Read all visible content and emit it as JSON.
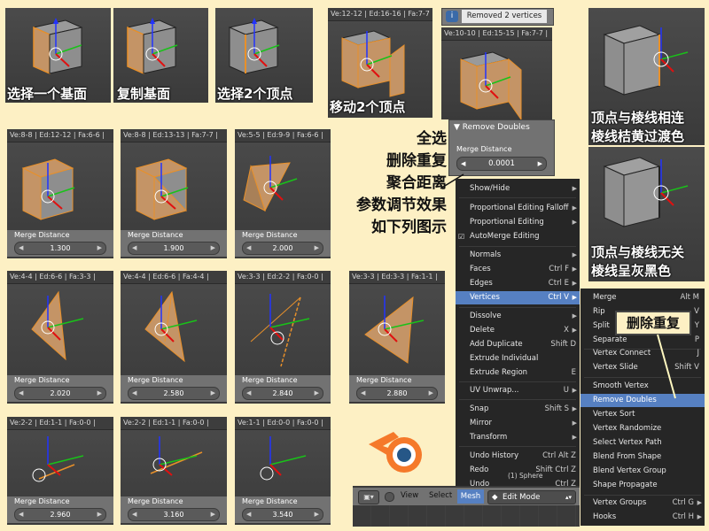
{
  "thumbs": {
    "t1": {
      "caption": "选择一个基面"
    },
    "t2": {
      "caption": "复制基面"
    },
    "t3": {
      "caption": "选择2个顶点"
    },
    "t4": {
      "header": "Ve:12-12 | Ed:16-16 | Fa:7-7 |",
      "caption": "移动2个顶点"
    },
    "t5": {
      "header": "Ve:10-10 | Ed:15-15 | Fa:7-7 |",
      "info": "Removed 2 vertices"
    },
    "r1": {
      "header": "Ve:8-8 | Ed:12-12 | Fa:6-6 |",
      "merge_label": "Merge Distance",
      "merge_value": "1.300"
    },
    "r2": {
      "header": "Ve:8-8 | Ed:13-13 | Fa:7-7 |",
      "merge_label": "Merge Distance",
      "merge_value": "1.900"
    },
    "r3": {
      "header": "Ve:5-5 | Ed:9-9 | Fa:6-6 |",
      "merge_label": "Merge Distance",
      "merge_value": "2.000"
    },
    "r4": {
      "header": "Ve:4-4 | Ed:6-6 | Fa:3-3 |",
      "merge_label": "Merge Distance",
      "merge_value": "2.020"
    },
    "r5": {
      "header": "Ve:4-4 | Ed:6-6 | Fa:4-4 |",
      "merge_label": "Merge Distance",
      "merge_value": "2.580"
    },
    "r6": {
      "header": "Ve:3-3 | Ed:2-2 | Fa:0-0 |",
      "merge_label": "Merge Distance",
      "merge_value": "2.840"
    },
    "r7": {
      "header": "Ve:3-3 | Ed:3-3 | Fa:1-1 |",
      "merge_label": "Merge Distance",
      "merge_value": "2.880"
    },
    "r8": {
      "header": "Ve:2-2 | Ed:1-1 | Fa:0-0 |",
      "merge_label": "Merge Distance",
      "merge_value": "2.960"
    },
    "r9": {
      "header": "Ve:2-2 | Ed:1-1 | Fa:0-0 |",
      "merge_label": "Merge Distance",
      "merge_value": "3.160"
    },
    "r10": {
      "header": "Ve:1-1 | Ed:0-0 | Fa:0-0 |",
      "merge_label": "Merge Distance",
      "merge_value": "3.540"
    }
  },
  "remove_doubles_panel": {
    "title": "Remove Doubles",
    "merge_label": "Merge Distance",
    "merge_value": "0.0001"
  },
  "annotation_center": [
    "全选",
    "删除重复",
    "聚合距离",
    "参数调节效果",
    "如下列图示"
  ],
  "right_captions": {
    "top": [
      "顶点与棱线相连",
      "棱线桔黄过渡色"
    ],
    "bottom": [
      "顶点与棱线无关",
      "棱线呈灰黑色"
    ]
  },
  "callout": "删除重复",
  "mesh_menu": [
    {
      "label": "Show/Hide",
      "sub": true
    },
    {
      "label": "Proportional Editing Falloff",
      "sub": true
    },
    {
      "label": "Proportional Editing",
      "sub": true
    },
    {
      "label": "AutoMerge Editing",
      "check": true
    },
    {
      "label": "Normals",
      "sub": true
    },
    {
      "label": "Faces",
      "shortcut": "Ctrl F",
      "sub": true
    },
    {
      "label": "Edges",
      "shortcut": "Ctrl E",
      "sub": true
    },
    {
      "label": "Vertices",
      "shortcut": "Ctrl V",
      "sub": true,
      "active": true
    },
    {
      "label": "Dissolve",
      "sub": true
    },
    {
      "label": "Delete",
      "shortcut": "X",
      "sub": true
    },
    {
      "label": "Add Duplicate",
      "shortcut": "Shift D"
    },
    {
      "label": "Extrude Individual"
    },
    {
      "label": "Extrude Region",
      "shortcut": "E"
    },
    {
      "label": "UV Unwrap...",
      "shortcut": "U",
      "sub": true
    },
    {
      "label": "Snap",
      "shortcut": "Shift S",
      "sub": true
    },
    {
      "label": "Mirror",
      "sub": true
    },
    {
      "label": "Transform",
      "sub": true
    },
    {
      "label": "Undo History",
      "shortcut": "Ctrl Alt Z"
    },
    {
      "label": "Redo",
      "shortcut": "Shift Ctrl Z"
    },
    {
      "label": "Undo",
      "shortcut": "Ctrl Z"
    }
  ],
  "vertices_menu": [
    {
      "label": "Merge",
      "shortcut": "Alt M"
    },
    {
      "label": "Rip",
      "shortcut": "V"
    },
    {
      "label": "Split",
      "shortcut": "Y"
    },
    {
      "label": "Separate",
      "shortcut": "P"
    },
    {
      "label": "Vertex Connect",
      "shortcut": "J"
    },
    {
      "label": "Vertex Slide",
      "shortcut": "Shift V"
    },
    {
      "label": "Smooth Vertex"
    },
    {
      "label": "Remove Doubles",
      "active": true
    },
    {
      "label": "Vertex Sort"
    },
    {
      "label": "Vertex Randomize"
    },
    {
      "label": "Select Vertex Path"
    },
    {
      "label": "Blend From Shape"
    },
    {
      "label": "Blend Vertex Group"
    },
    {
      "label": "Shape Propagate"
    },
    {
      "label": "Vertex Groups",
      "shortcut": "Ctrl G",
      "sub": true
    },
    {
      "label": "Hooks",
      "shortcut": "Ctrl H",
      "sub": true
    }
  ],
  "header_bar": {
    "view": "View",
    "select": "Select",
    "mesh": "Mesh",
    "mode": "Edit Mode",
    "object_hint": "(1) Sphere"
  },
  "colors": {
    "background": "#fdf0c4",
    "face_orange": "#c89a6a",
    "menu_bg": "#262626",
    "highlight": "#5680c2"
  }
}
